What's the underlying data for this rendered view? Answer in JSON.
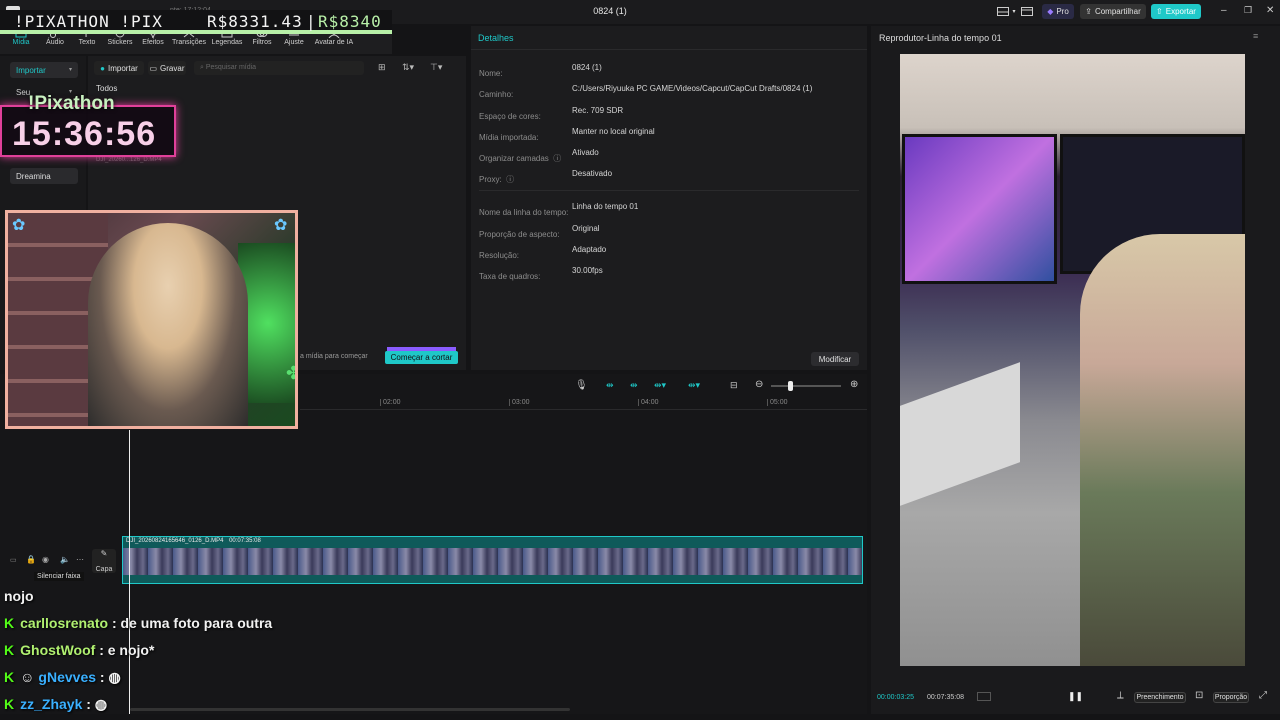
{
  "window": {
    "title": "0824 (1)",
    "pro_label": "Pro",
    "share_label": "Compartilhar",
    "export_label": "Exportar"
  },
  "toolbar": {
    "items": [
      {
        "label": "Mídia"
      },
      {
        "label": "Áudio"
      },
      {
        "label": "Texto"
      },
      {
        "label": "Stickers"
      },
      {
        "label": "Efeitos"
      },
      {
        "label": "Transições"
      },
      {
        "label": "Legendas"
      },
      {
        "label": "Filtros"
      },
      {
        "label": "Ajuste"
      },
      {
        "label": "Avatar de IA"
      }
    ]
  },
  "media": {
    "import_select": "Importar",
    "yours_select": "Seu",
    "dreamina": "Dreamina",
    "import_button": "Importar",
    "record_button": "Gravar",
    "search_placeholder": "Pesquisar mídia",
    "all_tab": "Todos",
    "file_name": "DJI_20260...126_D.MP4",
    "drop_hint": "a mídia para começar",
    "start_cut_button": "Começar a cortar"
  },
  "details": {
    "header": "Detalhes",
    "rows": [
      {
        "label": "Nome:",
        "value": "0824 (1)"
      },
      {
        "label": "Caminho:",
        "value": "C:/Users/Riyuuka PC GAME/Videos/Capcut/CapCut Drafts/0824 (1)"
      },
      {
        "label": "Espaço de cores:",
        "value": "Rec. 709 SDR"
      },
      {
        "label": "Mídia importada:",
        "value": "Manter no local original"
      },
      {
        "label": "Organizar camadas",
        "value": "Ativado"
      },
      {
        "label": "Proxy:",
        "value": "Desativado"
      }
    ],
    "rows2": [
      {
        "label": "Nome da linha do tempo:",
        "value": "Linha do tempo 01"
      },
      {
        "label": "Proporção de aspecto:",
        "value": "Original"
      },
      {
        "label": "Resolução:",
        "value": "Adaptado"
      },
      {
        "label": "Taxa de quadros:",
        "value": "30.00fps"
      }
    ],
    "modify_button": "Modificar"
  },
  "player": {
    "header": "Reprodutor-Linha do tempo 01",
    "current_time": "00:00:03:25",
    "total_time": "00:07:35:08",
    "fill_button": "Preenchimento",
    "ratio_button": "Proporção"
  },
  "timeline": {
    "ruler": [
      "02:00",
      "03:00",
      "04:00",
      "05:00"
    ],
    "clip_name": "DJI_20260824165646_0126_D.MP4",
    "clip_duration": "00:07:35:08",
    "cover_label": "Capa",
    "tooltip": "Silenciar faixa"
  },
  "overlay": {
    "banner_left": "!PIXATHON !PIX",
    "amount_current": "R$8331.43",
    "amount_goal": "R$8340",
    "clock_title": "!Pixathon",
    "clock_time": "15:36:56",
    "faint_time": "17:12:04",
    "faint_text": "nte:"
  },
  "chat": {
    "partial": "nojo",
    "messages": [
      {
        "user": "carllosrenato",
        "text": ": de uma foto para outra",
        "color": "#b0f070"
      },
      {
        "user": "GhostWoof",
        "text": ": e nojo*",
        "color": "#b0f070"
      },
      {
        "user": "gNevves",
        "text": ":",
        "color": "#3ab0ff"
      },
      {
        "user": "zz_Zhayk",
        "text": ":",
        "color": "#3ab0ff"
      }
    ]
  },
  "colors": {
    "accent": "#1fc8c8",
    "export": "#1fc8c8",
    "pink": "#e0409a"
  }
}
